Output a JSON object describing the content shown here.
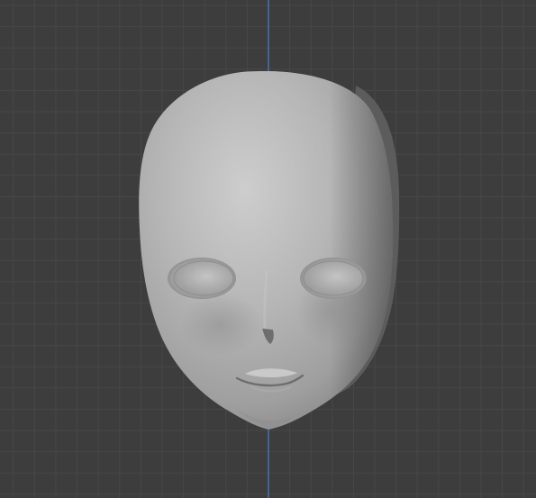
{
  "viewport": {
    "background_color": "#3d3d3d",
    "grid_minor_color": "#474747",
    "grid_major_color": "#4f4f4f",
    "y_axis_color": "#4a80c6",
    "x_axis_visible": false,
    "grid_visible": true
  },
  "model": {
    "object": "head-sculpt",
    "shading": "solid",
    "base_color": "#b7b7b7",
    "highlight_color": "#cfcfcf",
    "shadow_color": "#6a6a6a"
  }
}
